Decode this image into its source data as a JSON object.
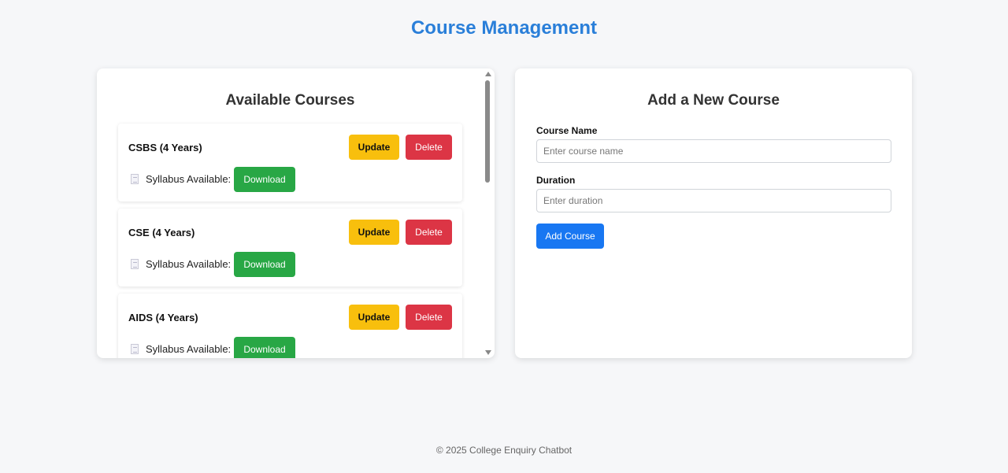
{
  "page_title": "Course Management",
  "courses_panel": {
    "heading": "Available Courses",
    "courses": [
      {
        "title": "CSBS (4 Years)",
        "update_label": "Update",
        "delete_label": "Delete",
        "syllabus_label": "Syllabus Available:",
        "download_label": "Download"
      },
      {
        "title": "CSE (4 Years)",
        "update_label": "Update",
        "delete_label": "Delete",
        "syllabus_label": "Syllabus Available:",
        "download_label": "Download"
      },
      {
        "title": "AIDS (4 Years)",
        "update_label": "Update",
        "delete_label": "Delete",
        "syllabus_label": "Syllabus Available:",
        "download_label": "Download"
      }
    ]
  },
  "add_panel": {
    "heading": "Add a New Course",
    "course_name_label": "Course Name",
    "course_name_placeholder": "Enter course name",
    "course_name_value": "",
    "duration_label": "Duration",
    "duration_placeholder": "Enter duration",
    "duration_value": "",
    "submit_label": "Add Course"
  },
  "footer": "© 2025 College Enquiry Chatbot",
  "colors": {
    "title": "#2a7fd9",
    "update": "#f8bf0d",
    "delete": "#dc3545",
    "download": "#28a745",
    "primary": "#1877f2"
  },
  "icons": {
    "syllabus": "document-icon"
  }
}
